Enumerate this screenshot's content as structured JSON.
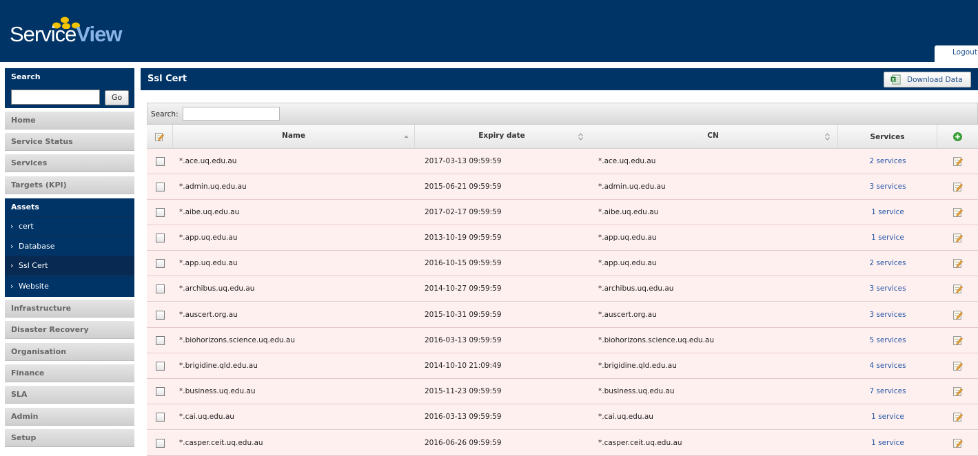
{
  "header": {
    "logo": {
      "part1": "Service",
      "part2": "View"
    },
    "logout_label": "Logout"
  },
  "sidebar": {
    "search_label": "Search",
    "search_value": "",
    "go_label": "Go",
    "nav_top": [
      "Home",
      "Service Status",
      "Services",
      "Targets (KPI)"
    ],
    "assets": {
      "label": "Assets",
      "items": [
        "cert",
        "Database",
        "Ssl Cert",
        "Website"
      ],
      "active": "Ssl Cert"
    },
    "nav_bottom": [
      "Infrastructure",
      "Disaster Recovery",
      "Organisation",
      "Finance",
      "SLA",
      "Admin",
      "Setup"
    ]
  },
  "main": {
    "title": "Ssl Cert",
    "download_label": "Download Data",
    "filter_label": "Search:",
    "filter_value": "",
    "columns": {
      "name": "Name",
      "expiry": "Expiry date",
      "cn": "CN",
      "services": "Services"
    },
    "rows": [
      {
        "name": "*.ace.uq.edu.au",
        "expiry": "2017-03-13 09:59:59",
        "cn": "*.ace.uq.edu.au",
        "services": "2 services"
      },
      {
        "name": "*.admin.uq.edu.au",
        "expiry": "2015-06-21 09:59:59",
        "cn": "*.admin.uq.edu.au",
        "services": "3 services"
      },
      {
        "name": "*.aibe.uq.edu.au",
        "expiry": "2017-02-17 09:59:59",
        "cn": "*.aibe.uq.edu.au",
        "services": "1 service"
      },
      {
        "name": "*.app.uq.edu.au",
        "expiry": "2013-10-19 09:59:59",
        "cn": "*.app.uq.edu.au",
        "services": "1 service"
      },
      {
        "name": "*.app.uq.edu.au",
        "expiry": "2016-10-15 09:59:59",
        "cn": "*.app.uq.edu.au",
        "services": "2 services"
      },
      {
        "name": "*.archibus.uq.edu.au",
        "expiry": "2014-10-27 09:59:59",
        "cn": "*.archibus.uq.edu.au",
        "services": "3 services"
      },
      {
        "name": "*.auscert.org.au",
        "expiry": "2015-10-31 09:59:59",
        "cn": "*.auscert.org.au",
        "services": "3 services"
      },
      {
        "name": "*.biohorizons.science.uq.edu.au",
        "expiry": "2016-03-13 09:59:59",
        "cn": "*.biohorizons.science.uq.edu.au",
        "services": "5 services"
      },
      {
        "name": "*.brigidine.qld.edu.au",
        "expiry": "2014-10-10 21:09:49",
        "cn": "*.brigidine.qld.edu.au",
        "services": "4 services"
      },
      {
        "name": "*.business.uq.edu.au",
        "expiry": "2015-11-23 09:59:59",
        "cn": "*.business.uq.edu.au",
        "services": "7 services"
      },
      {
        "name": "*.cai.uq.edu.au",
        "expiry": "2016-03-13 09:59:59",
        "cn": "*.cai.uq.edu.au",
        "services": "1 service"
      },
      {
        "name": "*.casper.ceit.uq.edu.au",
        "expiry": "2016-06-26 09:59:59",
        "cn": "*.casper.ceit.uq.edu.au",
        "services": "1 service"
      }
    ]
  },
  "colors": {
    "header_bg": "#003366",
    "row_bg": "#fff0f0",
    "link": "#2255a4"
  },
  "icons": {
    "select_all": "edit-icon",
    "add": "add-icon",
    "row_action": "edit-icon",
    "download": "excel-icon"
  }
}
